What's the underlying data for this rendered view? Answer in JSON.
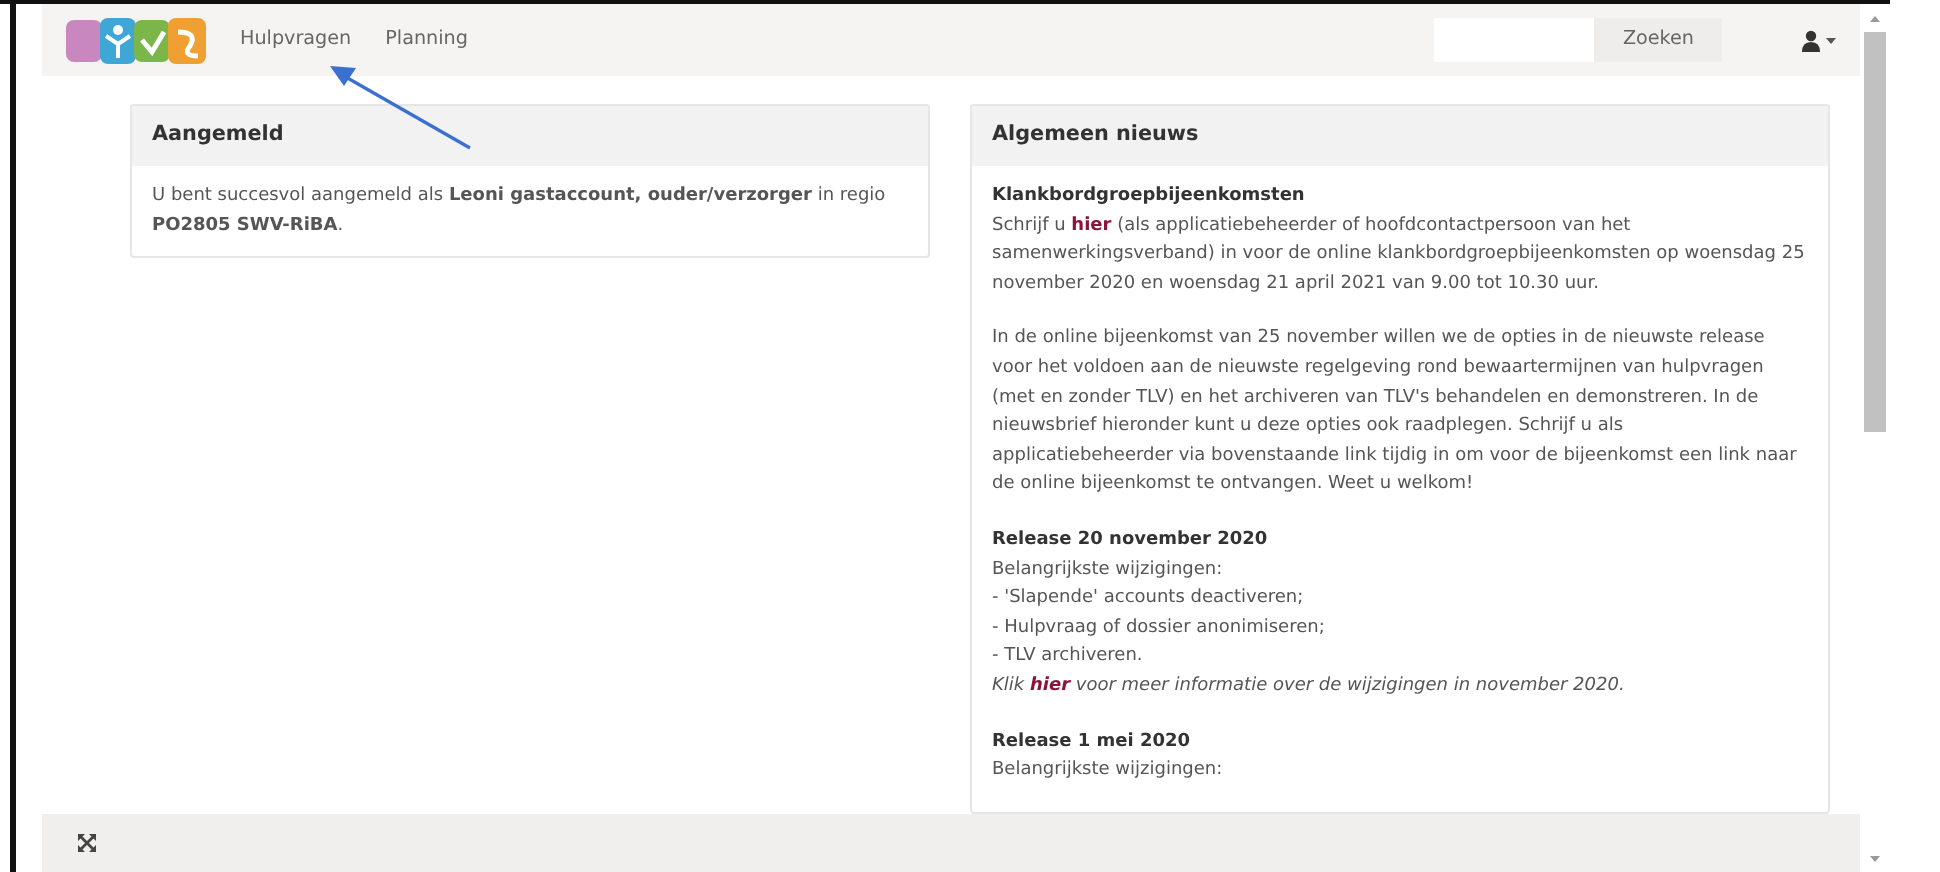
{
  "navbar": {
    "links": [
      {
        "label": "Hulpvragen"
      },
      {
        "label": "Planning"
      }
    ],
    "search_button": "Zoeken"
  },
  "login_panel": {
    "title": "Aangemeld",
    "text": "U bent succesvol aangemeld als **Leoni gastaccount, ouder/verzorger** in regio **PO2805 SWV-RiBA**."
  },
  "news_panel": {
    "title": "Algemeen nieuws",
    "items": [
      {
        "heading": "Klankbordgroepbijeenkomsten",
        "paragraphs": [
          [
            {
              "italic": false,
              "parts": [
                {
                  "kind": "text",
                  "text": "Schrijf u "
                },
                {
                  "kind": "link",
                  "text": "hier"
                },
                {
                  "kind": "text",
                  "text": " (als applicatiebeheerder of hoofdcontactpersoon van het samenwerkingsverband) in voor de online klankbordgroepbijeenkomsten op woensdag 25 november 2020 en woensdag 21 april 2021 van 9.00 tot 10.30 uur."
                }
              ]
            }
          ],
          [
            {
              "italic": false,
              "parts": [
                {
                  "kind": "text",
                  "text": "In de online bijeenkomst van 25 november willen we de opties in de nieuwste release voor het voldoen aan de nieuwste regelgeving rond bewaartermijnen van hulpvragen (met en zonder TLV) en het archiveren van TLV's behandelen en demonstreren. In de nieuwsbrief hieronder kunt u deze opties ook raadplegen. Schrijf u als applicatiebeheerder via bovenstaande link tijdig in om voor de bijeenkomst een link naar de online bijeenkomst te ontvangen. Weet u welkom!"
                }
              ]
            }
          ]
        ]
      },
      {
        "heading": "Release 20 november 2020",
        "paragraphs": [
          [
            {
              "italic": false,
              "parts": [
                {
                  "kind": "text",
                  "text": "Belangrijkste wijzigingen:"
                }
              ]
            },
            {
              "italic": false,
              "parts": [
                {
                  "kind": "text",
                  "text": "- 'Slapende' accounts deactiveren;"
                }
              ]
            },
            {
              "italic": false,
              "parts": [
                {
                  "kind": "text",
                  "text": "- Hulpvraag of dossier anonimiseren;"
                }
              ]
            },
            {
              "italic": false,
              "parts": [
                {
                  "kind": "text",
                  "text": "- TLV archiveren."
                }
              ]
            },
            {
              "italic": true,
              "parts": [
                {
                  "kind": "text",
                  "text": "Klik "
                },
                {
                  "kind": "link",
                  "text": "hier"
                },
                {
                  "kind": "text",
                  "text": " voor meer informatie over de wijzigingen in november 2020."
                }
              ]
            }
          ]
        ]
      },
      {
        "heading": "Release 1 mei 2020",
        "paragraphs": [
          [
            {
              "italic": false,
              "parts": [
                {
                  "kind": "text",
                  "text": "Belangrijkste wijzigingen:"
                }
              ]
            }
          ]
        ]
      }
    ]
  }
}
